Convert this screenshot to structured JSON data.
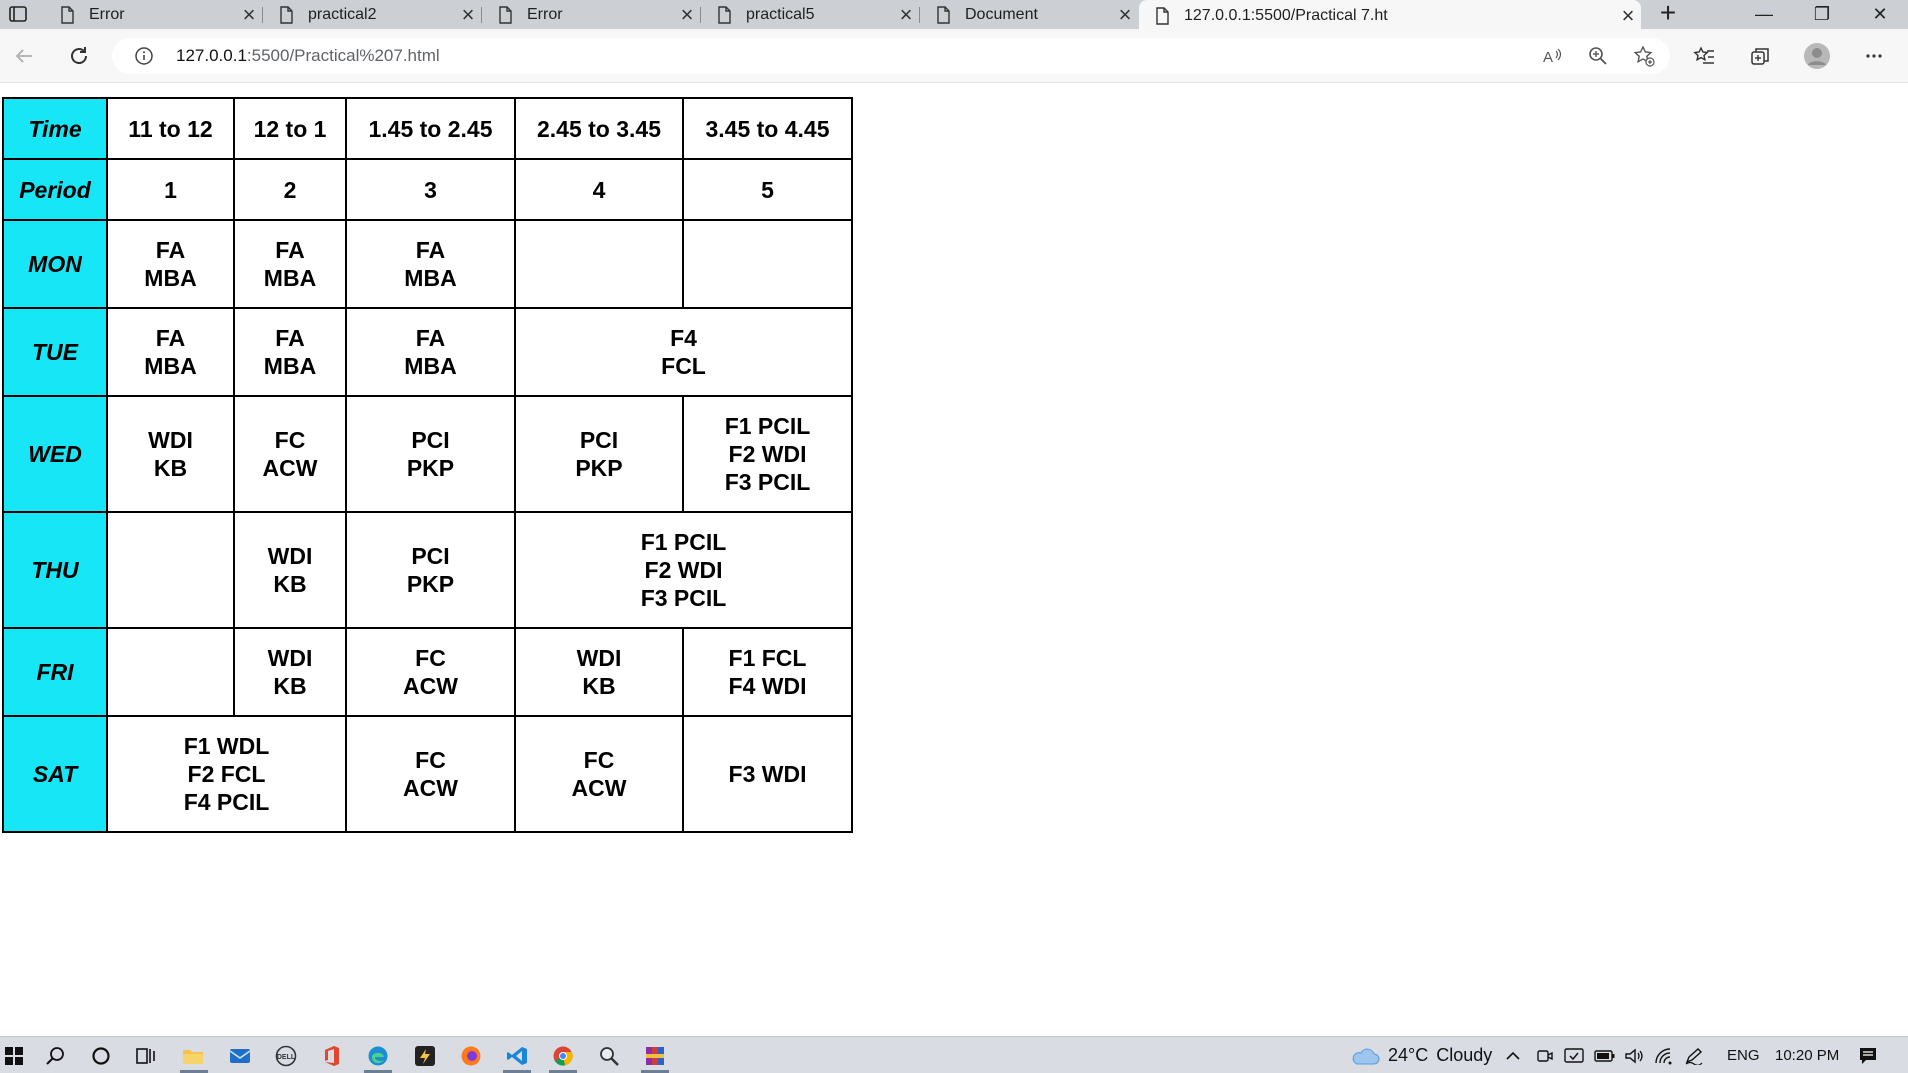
{
  "browser": {
    "tabs": [
      {
        "title": "Error",
        "active": false
      },
      {
        "title": "practical2",
        "active": false
      },
      {
        "title": "Error",
        "active": false
      },
      {
        "title": "practical5",
        "active": false
      },
      {
        "title": "Document",
        "active": false
      },
      {
        "title": "127.0.0.1:5500/Practical 7.ht",
        "active": true
      }
    ],
    "new_tab_label": "+",
    "window_controls": {
      "minimize": "—",
      "restore": "❐",
      "close": "✕"
    },
    "address": {
      "host": "127.0.0.1",
      "path": ":5500/Practical%207.html"
    }
  },
  "timetable": {
    "header_time_label": "Time",
    "header_period_label": "Period",
    "times": [
      "11 to 12",
      "12 to 1",
      "1.45 to 2.45",
      "2.45 to 3.45",
      "3.45 to 4.45"
    ],
    "periods": [
      "1",
      "2",
      "3",
      "4",
      "5"
    ],
    "rows": [
      {
        "day": "MON",
        "cells": [
          {
            "lines": [
              "FA",
              "MBA"
            ],
            "span": 1
          },
          {
            "lines": [
              "FA",
              "MBA"
            ],
            "span": 1
          },
          {
            "lines": [
              "FA",
              "MBA"
            ],
            "span": 1
          },
          {
            "lines": [],
            "span": 1
          },
          {
            "lines": [],
            "span": 1
          }
        ]
      },
      {
        "day": "TUE",
        "cells": [
          {
            "lines": [
              "FA",
              "MBA"
            ],
            "span": 1
          },
          {
            "lines": [
              "FA",
              "MBA"
            ],
            "span": 1
          },
          {
            "lines": [
              "FA",
              "MBA"
            ],
            "span": 1
          },
          {
            "lines": [
              "F4",
              "FCL"
            ],
            "span": 2
          }
        ]
      },
      {
        "day": "WED",
        "cells": [
          {
            "lines": [
              "WDI",
              "KB"
            ],
            "span": 1
          },
          {
            "lines": [
              "FC",
              "ACW"
            ],
            "span": 1
          },
          {
            "lines": [
              "PCI",
              "PKP"
            ],
            "span": 1
          },
          {
            "lines": [
              "PCI",
              "PKP"
            ],
            "span": 1
          },
          {
            "lines": [
              "F1 PCIL",
              "F2 WDI",
              "F3 PCIL"
            ],
            "span": 1
          }
        ]
      },
      {
        "day": "THU",
        "cells": [
          {
            "lines": [],
            "span": 1
          },
          {
            "lines": [
              "WDI",
              "KB"
            ],
            "span": 1
          },
          {
            "lines": [
              "PCI",
              "PKP"
            ],
            "span": 1
          },
          {
            "lines": [
              "F1 PCIL",
              "F2 WDI",
              "F3 PCIL"
            ],
            "span": 2
          }
        ]
      },
      {
        "day": "FRI",
        "cells": [
          {
            "lines": [],
            "span": 1
          },
          {
            "lines": [
              "WDI",
              "KB"
            ],
            "span": 1
          },
          {
            "lines": [
              "FC",
              "ACW"
            ],
            "span": 1
          },
          {
            "lines": [
              "WDI",
              "KB"
            ],
            "span": 1
          },
          {
            "lines": [
              "F1 FCL",
              "F4 WDI"
            ],
            "span": 1
          }
        ]
      },
      {
        "day": "SAT",
        "cells": [
          {
            "lines": [
              "F1 WDL",
              "F2 FCL",
              "F4 PCIL"
            ],
            "span": 2
          },
          {
            "lines": [
              "FC",
              "ACW"
            ],
            "span": 1
          },
          {
            "lines": [
              "FC",
              "ACW"
            ],
            "span": 1
          },
          {
            "lines": [
              "F3 WDI"
            ],
            "span": 1
          }
        ]
      }
    ],
    "colors": {
      "header_bg": "#17e6f6",
      "border": "#000000"
    }
  },
  "taskbar": {
    "weather": {
      "temp": "24°C",
      "condition": "Cloudy"
    },
    "language": "ENG",
    "time": "10:20 PM"
  }
}
